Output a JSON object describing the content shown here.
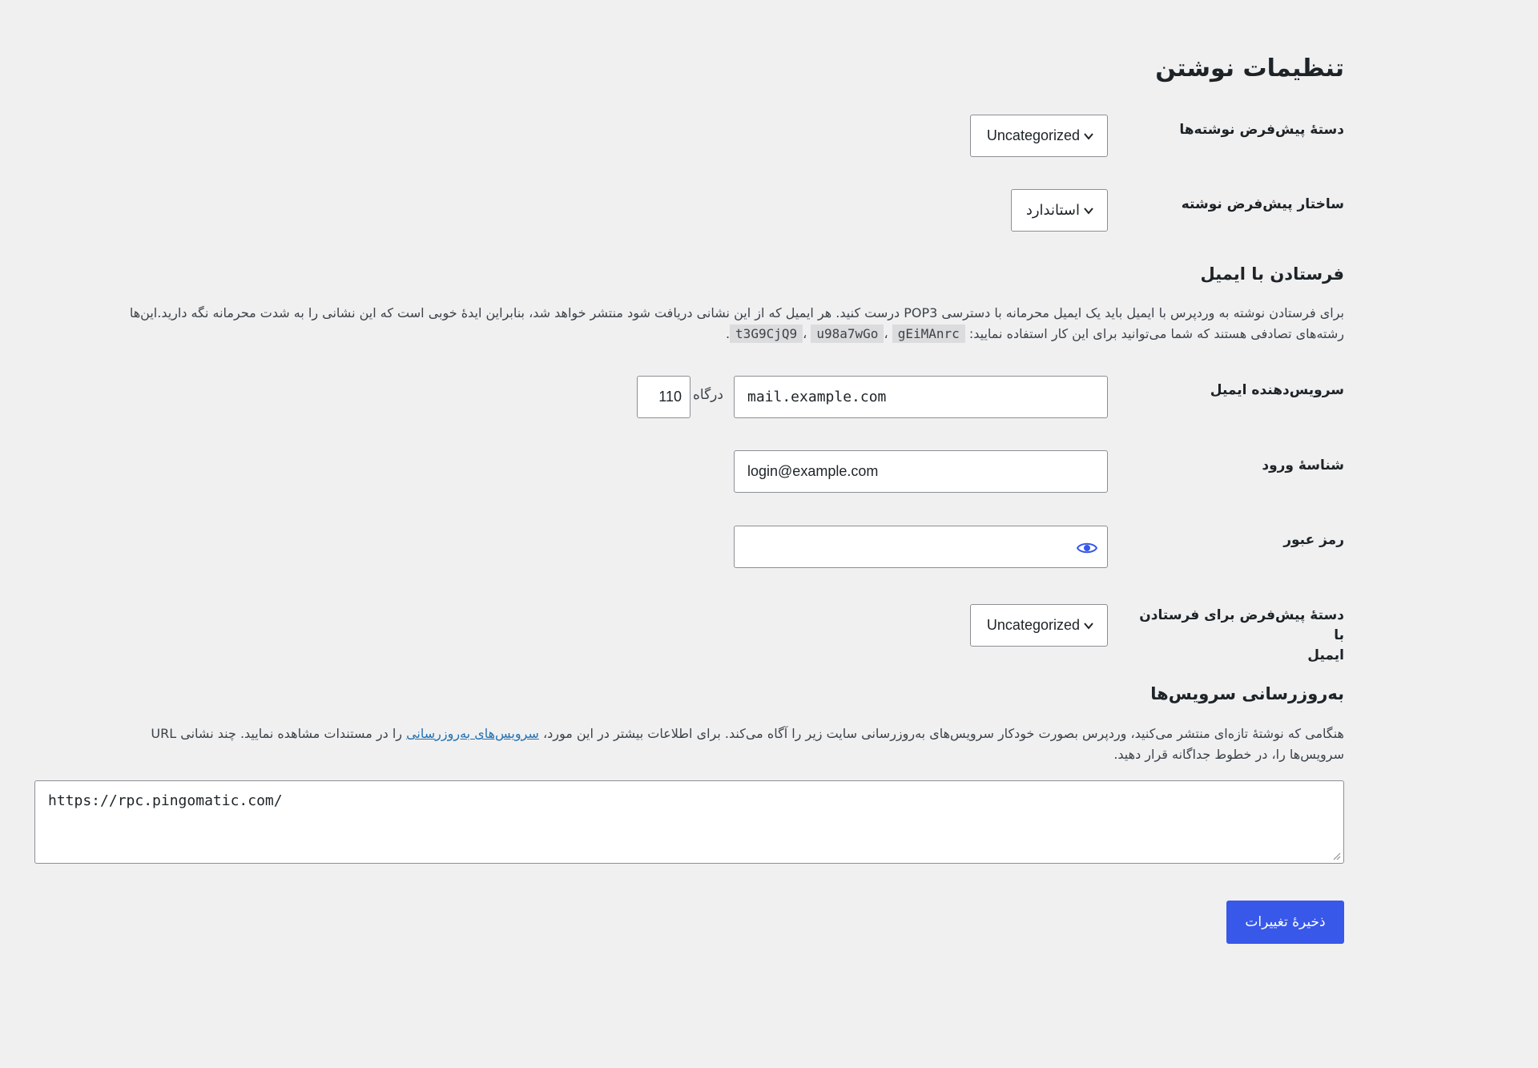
{
  "page": {
    "title": "تنظیمات نوشتن"
  },
  "fields": {
    "default_category": {
      "label": "دستهٔ پیش‌فرض نوشته‌ها",
      "value": "Uncategorized"
    },
    "default_format": {
      "label": "ساختار پیش‌فرض نوشته",
      "value": "استاندارد"
    }
  },
  "post_via_email": {
    "heading": "فرستادن با ایمیل",
    "description_line1": "برای فرستادن نوشته به وردپرس با ایمیل باید یک ایمیل محرمانه با دسترسی POP3 درست کنید. هر ایمیل که از این نشانی دریافت شود منتشر خواهد شد، بنابراین ایدهٔ خوبی است که این نشانی را به شدت محرمانه نگه دارید.این‌ها",
    "description_line2_prefix": "رشته‌های تصادفی هستند که شما می‌توانید برای این کار استفاده نمایید:",
    "random_strings": [
      "t3G9CjQ9",
      "u98a7wGo",
      "gEiMAnrc"
    ],
    "separator": "،",
    "end_punct": ".",
    "mail_server": {
      "label": "سرویس‌دهنده ایمیل",
      "value": "mail.example.com",
      "port_label": "درگاه",
      "port_value": "110"
    },
    "login": {
      "label": "شناسهٔ ورود",
      "value": "login@example.com"
    },
    "password": {
      "label": "رمز عبور",
      "value": "",
      "toggle_icon": "eye-icon"
    },
    "mail_category": {
      "label_line1": "دستهٔ پیش‌فرض برای فرستادن با",
      "label_line2": "ایمیل",
      "value": "Uncategorized"
    }
  },
  "update_services": {
    "heading": "به‌روزرسانی سرویس‌ها",
    "desc_part1": "هنگامی که نوشتهٔ تازه‌ای منتشر می‌کنید، وردپرس بصورت خودکار سرویس‌های به‌روزرسانی سایت زیر را آگاه می‌کند. برای اطلاعات بیشتر در این مورد،",
    "desc_link": "سرویس‌های به‌روزرسانی",
    "desc_part2": "را در مستندات مشاهده نمایید. چند نشانی URL",
    "desc_line2": "سرویس‌ها را، در خطوط جداگانه قرار دهید.",
    "ping_sites": "https://rpc.pingomatic.com/"
  },
  "save_button": "ذخیرهٔ تغییرات",
  "colors": {
    "background": "#f0f0f1",
    "primary": "#3858e9",
    "link": "#2271b1"
  }
}
